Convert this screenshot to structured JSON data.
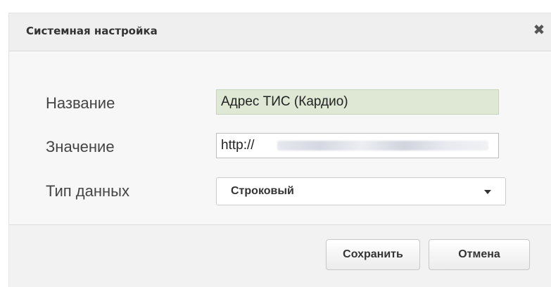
{
  "dialog": {
    "title": "Системная настройка",
    "close_icon": "close-icon"
  },
  "form": {
    "name_label": "Название",
    "name_value": "Адрес ТИС (Кардио)",
    "value_label": "Значение",
    "value_visible_text": "http://",
    "type_label": "Тип данных",
    "type_selected": "Строковый",
    "type_caret_icon": "chevron-down-icon"
  },
  "buttons": {
    "save": "Сохранить",
    "cancel": "Отмена"
  },
  "colors": {
    "readonly_field_bg": "#dfe8d5",
    "dialog_bg": "#f5f5f5"
  }
}
